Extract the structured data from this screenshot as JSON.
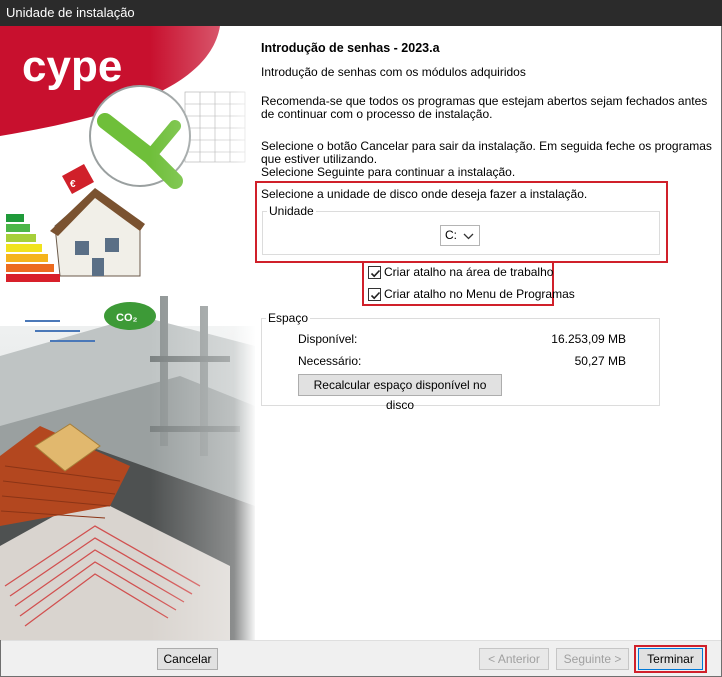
{
  "window": {
    "title": "Unidade de instalação"
  },
  "brand": {
    "logo_text": "cype",
    "accent_color": "#c8102e"
  },
  "content": {
    "heading": "Introdução de senhas - 2023.a",
    "subtitle": "Introdução de senhas com os módulos adquiridos",
    "recommend_line1": "Recomenda-se que todos os programas que estejam abertos sejam fechados antes",
    "recommend_line2": "de continuar com o processo de instalação.",
    "instr_line1": "Selecione o botão Cancelar para sair da instalação. Em seguida feche os programas",
    "instr_line2": "que estiver utilizando.",
    "instr_line3": "Selecione Seguinte para continuar a instalação.",
    "select_disk": "Selecione a unidade de disco onde deseja fazer a instalação.",
    "unit_group_label": "Unidade",
    "drive_value": "C:"
  },
  "shortcuts": {
    "desktop_label": "Criar atalho na área de trabalho",
    "desktop_checked": true,
    "menu_label": "Criar atalho no Menu de Programas",
    "menu_checked": true
  },
  "space": {
    "group_label": "Espaço",
    "available_label": "Disponível:",
    "available_value": "16.253,09 MB",
    "required_label": "Necessário:",
    "required_value": "50,27 MB",
    "recalc_button": "Recalcular espaço disponível no disco"
  },
  "footer": {
    "cancel": "Cancelar",
    "previous": "< Anterior",
    "next": "Seguinte >",
    "finish": "Terminar"
  }
}
